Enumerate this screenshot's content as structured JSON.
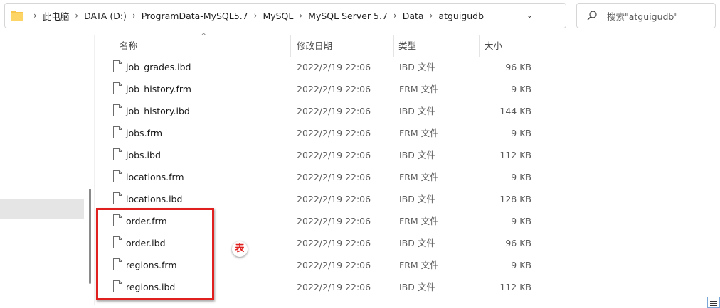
{
  "breadcrumb": [
    "此电脑",
    "DATA (D:)",
    "ProgramData-MySQL5.7",
    "MySQL",
    "MySQL Server 5.7",
    "Data",
    "atguigudb"
  ],
  "search": {
    "placeholder": "搜索\"atguigudb\""
  },
  "columns": {
    "name": "名称",
    "date": "修改日期",
    "type": "类型",
    "size": "大小"
  },
  "files": [
    {
      "name": "job_grades.ibd",
      "date": "2022/2/19 22:06",
      "type": "IBD 文件",
      "size": "96 KB"
    },
    {
      "name": "job_history.frm",
      "date": "2022/2/19 22:06",
      "type": "FRM 文件",
      "size": "9 KB"
    },
    {
      "name": "job_history.ibd",
      "date": "2022/2/19 22:06",
      "type": "IBD 文件",
      "size": "144 KB"
    },
    {
      "name": "jobs.frm",
      "date": "2022/2/19 22:06",
      "type": "FRM 文件",
      "size": "9 KB"
    },
    {
      "name": "jobs.ibd",
      "date": "2022/2/19 22:06",
      "type": "IBD 文件",
      "size": "112 KB"
    },
    {
      "name": "locations.frm",
      "date": "2022/2/19 22:06",
      "type": "FRM 文件",
      "size": "9 KB"
    },
    {
      "name": "locations.ibd",
      "date": "2022/2/19 22:06",
      "type": "IBD 文件",
      "size": "128 KB"
    },
    {
      "name": "order.frm",
      "date": "2022/2/19 22:06",
      "type": "FRM 文件",
      "size": "9 KB"
    },
    {
      "name": "order.ibd",
      "date": "2022/2/19 22:06",
      "type": "IBD 文件",
      "size": "96 KB"
    },
    {
      "name": "regions.frm",
      "date": "2022/2/19 22:06",
      "type": "FRM 文件",
      "size": "9 KB"
    },
    {
      "name": "regions.ibd",
      "date": "2022/2/19 22:06",
      "type": "IBD 文件",
      "size": "112 KB"
    }
  ],
  "annotation": {
    "label": "表",
    "color": "#e0201f"
  },
  "icons": {
    "folder": "folder-icon",
    "search": "search-icon",
    "file": "file-icon",
    "dropdown": "chevron-down-icon",
    "sort": "sort-up-icon"
  }
}
